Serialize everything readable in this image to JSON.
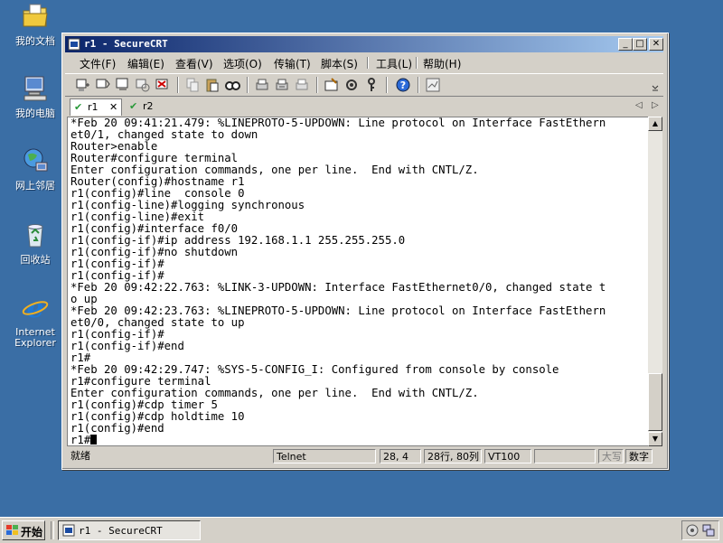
{
  "desktop": {
    "icons": [
      {
        "label": "我的文档",
        "icon": "folder-docs-icon"
      },
      {
        "label": "我的电脑",
        "icon": "computer-icon"
      },
      {
        "label": "网上邻居",
        "icon": "network-icon"
      },
      {
        "label": "回收站",
        "icon": "recycle-bin-icon"
      },
      {
        "label_line1": "Internet",
        "label_line2": "Explorer",
        "icon": "ie-icon"
      }
    ]
  },
  "window": {
    "title": "r1 - SecureCRT",
    "menu": [
      "文件(F)",
      "编辑(E)",
      "查看(V)",
      "选项(O)",
      "传输(T)",
      "脚本(S)",
      "工具(L)",
      "帮助(H)"
    ],
    "tabs": [
      {
        "label": "r1",
        "active": true
      },
      {
        "label": "r2",
        "active": false
      }
    ],
    "terminal_lines": [
      "*Feb 20 09:41:21.479: %LINEPROTO-5-UPDOWN: Line protocol on Interface FastEthern",
      "et0/1, changed state to down",
      "Router>enable",
      "Router#configure terminal",
      "Enter configuration commands, one per line.  End with CNTL/Z.",
      "Router(config)#hostname r1",
      "r1(config)#line  console 0",
      "r1(config-line)#logging synchronous",
      "r1(config-line)#exit",
      "r1(config)#interface f0/0",
      "r1(config-if)#ip address 192.168.1.1 255.255.255.0",
      "r1(config-if)#no shutdown",
      "r1(config-if)#",
      "r1(config-if)#",
      "*Feb 20 09:42:22.763: %LINK-3-UPDOWN: Interface FastEthernet0/0, changed state t",
      "o up",
      "*Feb 20 09:42:23.763: %LINEPROTO-5-UPDOWN: Line protocol on Interface FastEthern",
      "et0/0, changed state to up",
      "r1(config-if)#",
      "r1(config-if)#end",
      "r1#",
      "*Feb 20 09:42:29.747: %SYS-5-CONFIG_I: Configured from console by console",
      "r1#configure terminal",
      "Enter configuration commands, one per line.  End with CNTL/Z.",
      "r1(config)#cdp timer 5",
      "r1(config)#cdp holdtime 10",
      "r1(config)#end",
      "r1#"
    ],
    "status": {
      "ready": "就绪",
      "protocol": "Telnet",
      "cursor_pos": "28,  4",
      "size": "28行, 80列",
      "emulation": "VT100",
      "caps": "大写",
      "num": "数字"
    }
  },
  "taskbar": {
    "start_label": "开始",
    "task_label": "r1 - SecureCRT"
  },
  "colors": {
    "desktop": "#3a6ea5",
    "title_start": "#0a246a",
    "title_end": "#a6caf0",
    "face": "#d4d0c8"
  }
}
